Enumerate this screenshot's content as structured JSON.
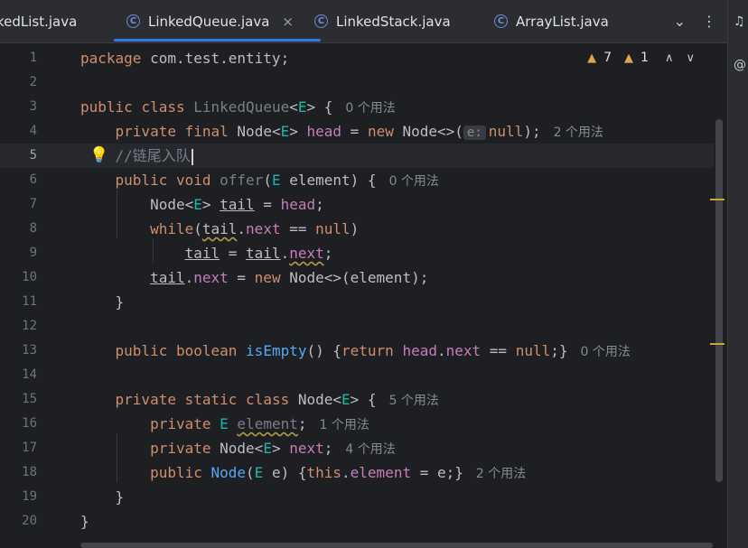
{
  "tabs": [
    {
      "label": "kedList.java",
      "active": false,
      "closable": false
    },
    {
      "label": "LinkedQueue.java",
      "active": true,
      "closable": true
    },
    {
      "label": "LinkedStack.java",
      "active": false,
      "closable": false
    },
    {
      "label": "ArrayList.java",
      "active": false,
      "closable": false
    }
  ],
  "tab_icon_glyph": "C",
  "tab_close_glyph": "×",
  "tab_tools": {
    "more_tabs": "⌄",
    "options": "⋮"
  },
  "inspections": {
    "warning_icon": "▲",
    "warnings": "7",
    "weak_warning_icon": "▲",
    "weak_warnings": "1"
  },
  "nav": {
    "prev": "∧",
    "next": "∨"
  },
  "right_strip": {
    "notifications": "♫",
    "assistant": "@"
  },
  "line_numbers": [
    "1",
    "2",
    "3",
    "4",
    "5",
    "6",
    "7",
    "8",
    "9",
    "10",
    "11",
    "12",
    "13",
    "14",
    "15",
    "16",
    "17",
    "18",
    "19",
    "20"
  ],
  "current_line": "5",
  "code": {
    "l1": {
      "kw": "package",
      "text": " com.test.entity;"
    },
    "l3": {
      "kw1": "public",
      "kw2": "class",
      "name": "LinkedQueue",
      "lt": "<",
      "gen": "E",
      "gt": ">",
      "open": " {",
      "hint": "0 个用法"
    },
    "l4": {
      "kw1": "private",
      "kw2": "final",
      "type": "Node<",
      "gen": "E",
      "gt": ">",
      "fld": "head",
      "eq": " = ",
      "kw3": "new",
      "ctor": " Node<>(",
      "param": "e:",
      "nul": "null",
      "end": ");",
      "hint": "2 个用法"
    },
    "l5": {
      "comment": "//链尾入队"
    },
    "l6": {
      "kw1": "public",
      "kw2": "void",
      "method": "offer",
      "open": "(",
      "gen": "E",
      "rest": " element) {",
      "hint": "0 个用法"
    },
    "l7": {
      "type": "Node<",
      "gen": "E",
      "gt": "> ",
      "var": "tail",
      "eq": " = ",
      "fld": "head",
      "end": ";"
    },
    "l8": {
      "kw": "while",
      "open": "(",
      "var": "tail",
      "dot": ".",
      "fld": "next",
      "op": " == ",
      "nul": "null",
      "close": ")"
    },
    "l9": {
      "var1": "tail",
      "eq": " = ",
      "var2": "tail",
      "dot": ".",
      "fld": "next",
      "end": ";"
    },
    "l10": {
      "var": "tail",
      "dot": ".",
      "fld": "next",
      "eq": " = ",
      "kw": "new",
      "rest": " Node<>(element);"
    },
    "l11": {
      "text": "}"
    },
    "l13": {
      "kw1": "public",
      "kw2": "boolean",
      "method": "isEmpty",
      "mid": "() {",
      "kw3": "return",
      "fld1": "head",
      "dot": ".",
      "fld2": "next",
      "op": " == ",
      "nul": "null",
      "end": ";}",
      "hint": "0 个用法"
    },
    "l15": {
      "kw1": "private",
      "kw2": "static",
      "kw3": "class",
      "name": " Node<",
      "gen": "E",
      "gt": ">",
      "open": " {",
      "hint": "5 个用法"
    },
    "l16": {
      "kw": "private",
      "gen": "E",
      "fld": "element",
      "end": ";",
      "hint": "1 个用法"
    },
    "l17": {
      "kw": "private",
      "type": "Node<",
      "gen": "E",
      "gt": ">",
      "fld": "next",
      "end": ";",
      "hint": "4 个用法"
    },
    "l18": {
      "kw": "public",
      "method": "Node",
      "open": "(",
      "gen": "E",
      "rest": " e) {",
      "kw2": "this",
      "dot": ".",
      "fld": "element",
      "tail": " = e;}",
      "hint": "2 个用法"
    },
    "l19": {
      "text": "}"
    },
    "l20": {
      "text": "}"
    }
  },
  "colors": {
    "keyword": "#cf8e6d",
    "type_param": "#16baac",
    "field": "#c77dbb",
    "method": "#56a8f5",
    "accent": "#3574f0",
    "warning": "#e0a74a"
  }
}
